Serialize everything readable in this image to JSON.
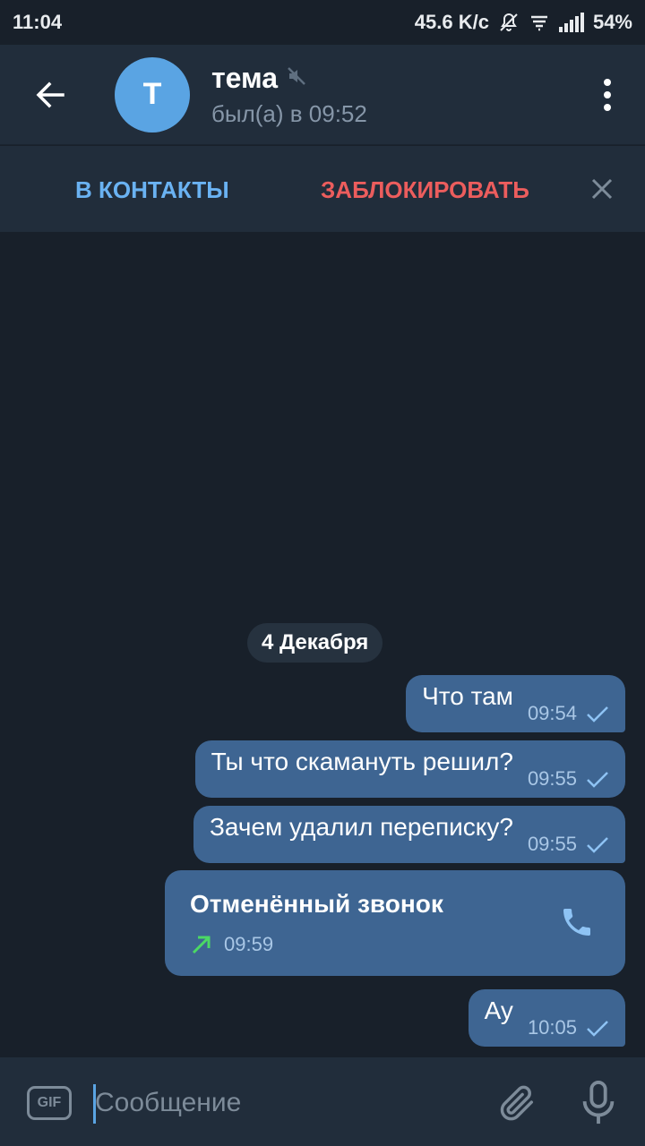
{
  "status_bar": {
    "time": "11:04",
    "network_speed": "45.6 K/c",
    "battery": "54%",
    "icons": [
      "notifications-off-icon",
      "data-icon",
      "signal-icon",
      "battery-icon"
    ]
  },
  "header": {
    "avatar_letter": "T",
    "avatar_color": "#5aa4e3",
    "title": "тема",
    "muted_icon": "speaker-muted-icon",
    "subtitle": "был(а) в 09:52"
  },
  "action_bar": {
    "add_contact_label": "В КОНТАКТЫ",
    "block_label": "ЗАБЛОКИРОВАТЬ"
  },
  "chat": {
    "date": "4 Декабря",
    "messages": [
      {
        "text": "Что там",
        "time": "09:54"
      },
      {
        "text": "Ты что скамануть решил?",
        "time": "09:55"
      },
      {
        "text": "Зачем удалил переписку?",
        "time": "09:55"
      },
      {
        "text": "Ау",
        "time": "10:05"
      }
    ],
    "call": {
      "title": "Отменённый звонок",
      "time": "09:59",
      "direction_icon": "outgoing-arrow-icon"
    }
  },
  "input": {
    "gif_label": "GIF",
    "placeholder": "Сообщение",
    "value": ""
  },
  "colors": {
    "background": "#18202a",
    "panel": "#212d3b",
    "bubble_out": "#3e6592",
    "accent": "#6ab2f2",
    "danger": "#ec5d5d",
    "call_arrow": "#4bd964"
  }
}
